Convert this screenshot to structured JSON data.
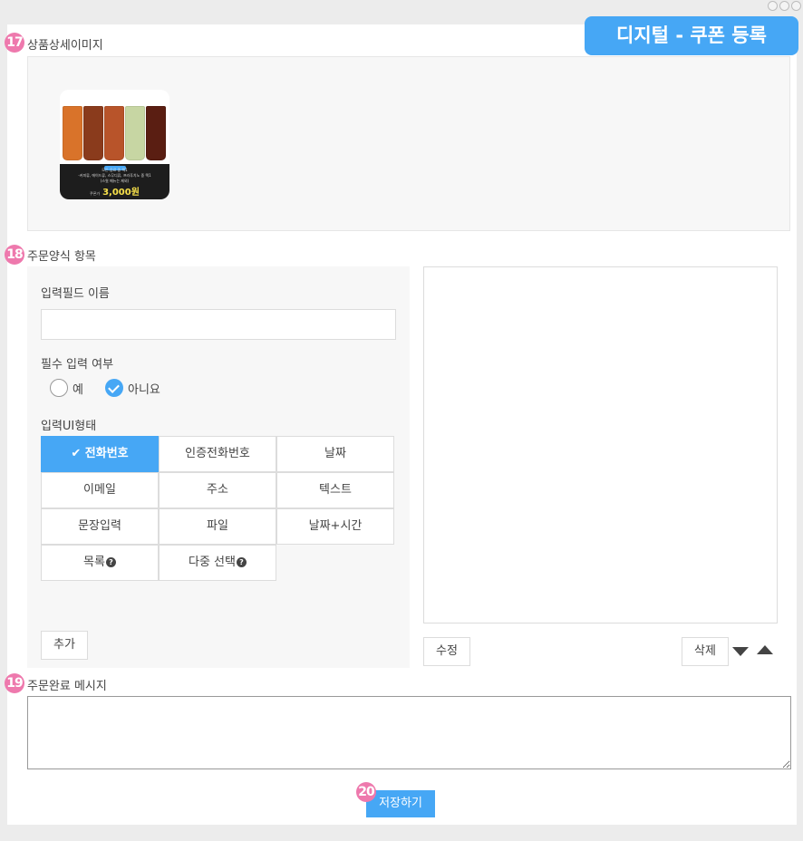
{
  "banner": {
    "title": "디지털 - 쿠폰 등록"
  },
  "badges": {
    "b17": "17",
    "b18": "18",
    "b19": "19",
    "b20": "20"
  },
  "sections": {
    "detail_image": "상품상세이미지",
    "order_form": "주문양식 항목",
    "complete_message": "주문완료 메시지"
  },
  "thumbnail": {
    "line1": "모든 음료 중 택1",
    "line2": "-커피류, 에이드류, 스무디류, 프라푸치노 중 택1",
    "line3": "(스윗 메뉴는 제외)",
    "price_label": "쿠폰가",
    "price": "3,000원",
    "cup_colors": [
      "#d9732a",
      "#8a3b1c",
      "#b8542a",
      "#c7d6a3",
      "#5a1e12"
    ]
  },
  "form": {
    "field_name_label": "입력필드 이름",
    "field_name_value": "",
    "required_label": "필수 입력 여부",
    "required_options": [
      {
        "label": "예",
        "checked": false
      },
      {
        "label": "아니요",
        "checked": true
      }
    ],
    "ui_type_label": "입력UI형태",
    "ui_types": [
      {
        "label": "전화번호",
        "selected": true,
        "help": false
      },
      {
        "label": "인증전화번호",
        "selected": false,
        "help": false
      },
      {
        "label": "날짜",
        "selected": false,
        "help": false
      },
      {
        "label": "이메일",
        "selected": false,
        "help": false
      },
      {
        "label": "주소",
        "selected": false,
        "help": false
      },
      {
        "label": "텍스트",
        "selected": false,
        "help": false
      },
      {
        "label": "문장입력",
        "selected": false,
        "help": false
      },
      {
        "label": "파일",
        "selected": false,
        "help": false
      },
      {
        "label": "날짜+시간",
        "selected": false,
        "help": false
      },
      {
        "label": "목록",
        "selected": false,
        "help": true
      },
      {
        "label": "다중 선택",
        "selected": false,
        "help": true
      }
    ],
    "add_button": "추가"
  },
  "preview": {
    "edit_button": "수정",
    "delete_button": "삭제"
  },
  "complete_message_value": "",
  "save_button": "저장하기",
  "colors": {
    "accent": "#46a7f5",
    "badge": "#ee79ad"
  }
}
